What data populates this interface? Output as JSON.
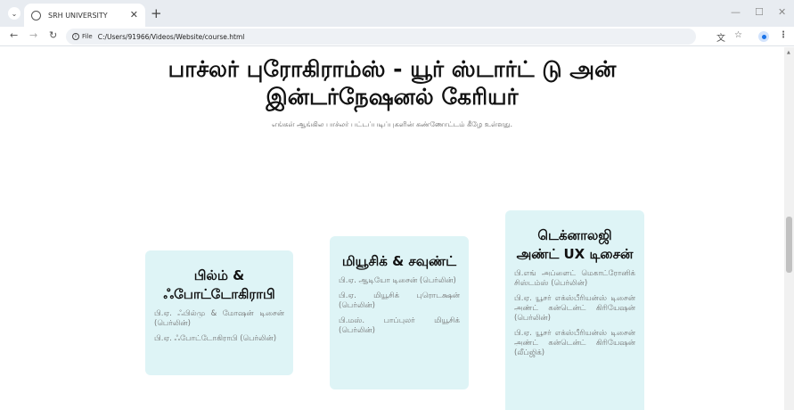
{
  "browser": {
    "tab_title": "SRH UNIVERSITY",
    "url_chip": "File",
    "url": "C:/Users/91966/Videos/Website/course.html",
    "icons": [
      "tab-search-icon",
      "globe-icon",
      "close-icon",
      "plus-icon",
      "back-icon",
      "forward-icon",
      "reload-icon",
      "info-icon",
      "translate-icon",
      "star-icon",
      "profile-icon",
      "kebab-menu-icon"
    ]
  },
  "hero": {
    "title": "பாச்லர் புரோகிராம்ஸ் - யூர் ஸ்டார்ட் டு அன் இன்டர்நேஷனல் கேரியர்",
    "subtitle": "எங்கள் ஆங்கில பாச்லர் பட்டப்படிப்புகளின் கண்ணோட்டம் கீழே உள்ளது."
  },
  "cards": [
    {
      "title": "பில்ம் & ஃபோட்டோகிராபி",
      "items": [
        "பி.ஏ. ஃபில்மு & மோஷன் டிசைன் (பெர்லின்)",
        "பி.ஏ. ஃபோட்டோகிராபி (பெர்லின்)"
      ]
    },
    {
      "title": "மியூசிக் & சவுண்ட்",
      "items": [
        "பி.ஏ. ஆடியோ டிசைன் (பெர்லின்)",
        "பி.ஏ. மியூசிக் புரொடக்ஷன் (பெர்லின்)",
        "பி.மஸ். பாப்புலர் மியூசிக் (பெர்லின்)"
      ]
    },
    {
      "title": "டெக்னாலஜி அண்ட் UX டிசைன்",
      "items": [
        "பி.எங் அப்ளைட் மெகாட்ரோனிக் சிஸ்டம்ஸ் (பெர்லின்)",
        "பி.ஏ. யூசர் எக்ஸ்பீரியன்ஸ் டிசைன் அண்ட் கன்டென்ட் கிரியேஷன் (பெர்லின்)",
        "பி.ஏ. யூசர் எக்ஸ்பீரியன்ஸ் டிசைன் அண்ட் கன்டென்ட் கிரியேஷன் (லீப்ஜிக்)"
      ]
    }
  ]
}
